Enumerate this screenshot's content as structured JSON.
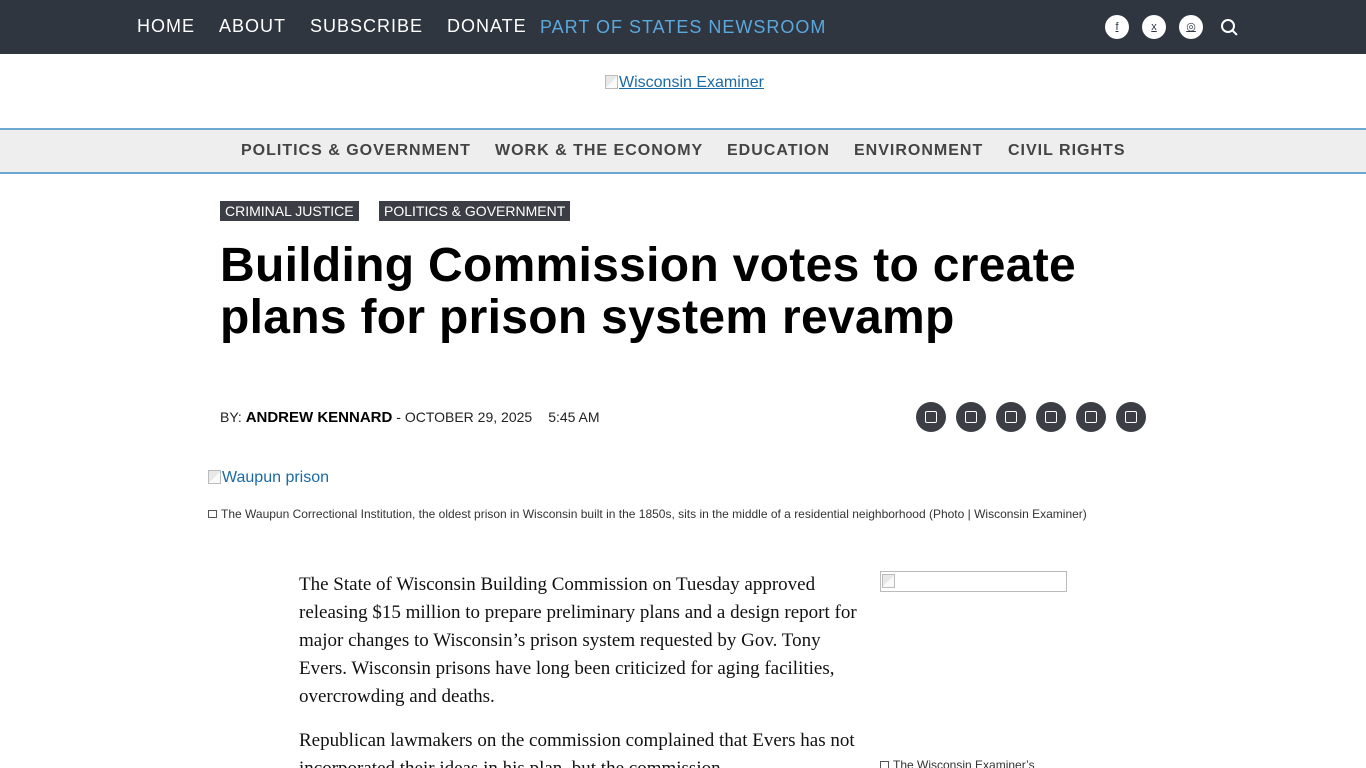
{
  "top_nav": {
    "items": [
      "HOME",
      "ABOUT",
      "SUBSCRIBE",
      "DONATE"
    ],
    "network_link": "PART OF STATES NEWSROOM"
  },
  "social_icons": [
    "facebook-icon",
    "twitter-icon",
    "instagram-icon"
  ],
  "logo_alt": "Wisconsin Examiner",
  "category_nav": [
    "POLITICS & GOVERNMENT",
    "WORK & THE ECONOMY",
    "EDUCATION",
    "ENVIRONMENT",
    "CIVIL RIGHTS"
  ],
  "article": {
    "tags": [
      "CRIMINAL JUSTICE",
      "POLITICS & GOVERNMENT"
    ],
    "headline": "Building Commission votes to create plans for prison system revamp",
    "byline_prefix": "BY: ",
    "author": "ANDREW KENNARD",
    "separator": " - ",
    "date": "OCTOBER 29, 2025",
    "time": "5:45 AM",
    "share_icons": [
      "facebook-share-icon",
      "twitter-share-icon",
      "email-share-icon",
      "print-share-icon",
      "republish-icon",
      "link-share-icon"
    ],
    "hero_alt": "Waupun prison",
    "hero_caption": "The Waupun Correctional Institution, the oldest prison in Wisconsin built in the 1850s, sits in the middle of a residential neighborhood (Photo | Wisconsin Examiner)",
    "paragraphs": [
      "The State of Wisconsin Building Commission on Tuesday approved releasing $15 million to prepare preliminary plans and a design report for major changes to Wisconsin’s prison system requested by Gov. Tony Evers. Wisconsin prisons have long been criticized for aging facilities, overcrowding and deaths.",
      "Republican lawmakers on the commission complained that Evers has not incorporated their ideas in his plan, but the commission"
    ],
    "side_caption": "The Wisconsin Examiner’s"
  }
}
